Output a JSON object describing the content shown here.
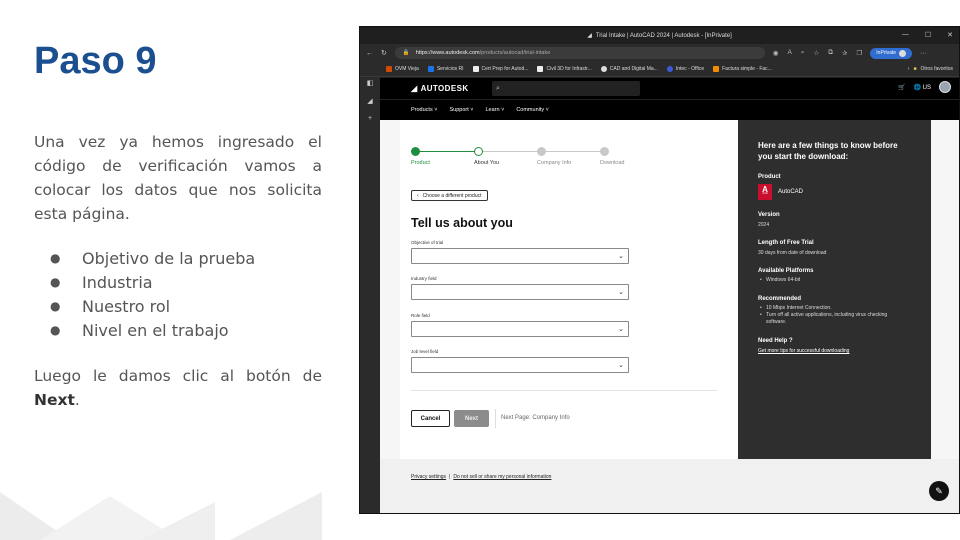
{
  "slide": {
    "title": "Paso 9",
    "intro": "Una vez ya hemos ingresado el código de verificación vamos a colocar los datos que nos solicita esta página.",
    "bullets": [
      "Objetivo de la prueba",
      "Industria",
      "Nuestro rol",
      "Nivel en el trabajo"
    ],
    "outro_prefix": "Luego le damos clic al botón de ",
    "outro_bold": "Next",
    "outro_suffix": "."
  },
  "browser": {
    "window_title": "Trial Intake | AutoCAD 2024 | Autodesk - [InPrivate]",
    "url_host": "https://www.autodesk.com",
    "url_path": "/products/autocad/trial-intake",
    "inprivate_label": "InPrivate",
    "bookmarks": [
      "OVM Vieja",
      "Servicios RI",
      "Cert Prep for Autod...",
      "Civil 3D for Infrastr...",
      "CAD and Digital Ma...",
      "Intec - Office",
      "Factura simple - Fac..."
    ],
    "other_favorites": "Otros favoritos"
  },
  "autodesk": {
    "logo": "AUTODESK",
    "lang": "US",
    "nav": [
      "Products",
      "Support",
      "Learn",
      "Community"
    ],
    "steps": [
      "Product",
      "About You",
      "Company Info",
      "Download"
    ],
    "back_label": "Choose a different product",
    "form_title": "Tell us about you",
    "fields": [
      "Objective of trial",
      "Industry field",
      "Role field",
      "Job level field"
    ],
    "cancel_label": "Cancel",
    "next_label": "Next",
    "next_page": "Next Page: Company Info",
    "panel": {
      "title": "Here are a few things to know before you start the download:",
      "product_h": "Product",
      "product": "AutoCAD",
      "product_logo": "A",
      "product_logo_sub": "CAD",
      "version_h": "Version",
      "version": "2024",
      "trial_h": "Length of Free Trial",
      "trial": "30 days from date of download",
      "platforms_h": "Available Platforms",
      "platforms": [
        "Windows 64-bit"
      ],
      "recommended_h": "Recommended",
      "recommended": [
        "10 Mbps Internet Connection.",
        "Turn off all active applications, including virus checking software."
      ],
      "help_h": "Need Help ?",
      "help_link": "Get more tips for successful downloading"
    },
    "footer": {
      "privacy": "Privacy settings",
      "sep": "|",
      "do_not_sell": "Do not sell or share my personal information"
    }
  },
  "colors": {
    "title_blue": "#1b4f8f",
    "step_green": "#1e8e3e",
    "step_grey": "#c8c8c8"
  }
}
